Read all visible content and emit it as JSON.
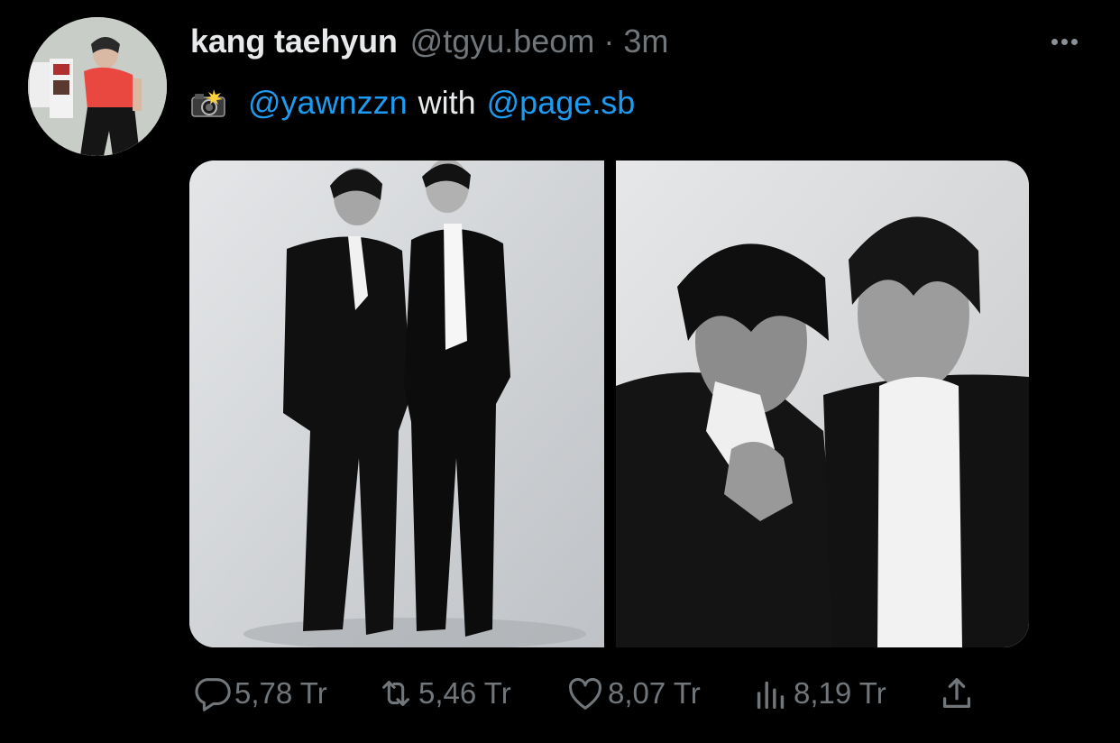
{
  "tweet": {
    "author": {
      "display_name": "kang taehyun",
      "handle": "@tgyu.beom",
      "avatar_icon": "avatar-photo"
    },
    "separator": "·",
    "timestamp": "3m",
    "text": {
      "emoji": "📸",
      "mention_1": "@yawnzzn",
      "connector": "with",
      "mention_2": "@page.sb"
    },
    "media": [
      {
        "alt_icon": "photo-two-men-in-suits-full-body"
      },
      {
        "alt_icon": "photo-two-men-close-up"
      }
    ],
    "actions": {
      "reply": {
        "icon": "reply-icon",
        "count": "5,78 Tr"
      },
      "retweet": {
        "icon": "retweet-icon",
        "count": "5,46 Tr"
      },
      "like": {
        "icon": "heart-icon",
        "count": "8,07 Tr"
      },
      "views": {
        "icon": "views-icon",
        "count": "8,19 Tr"
      },
      "share": {
        "icon": "share-icon"
      }
    }
  },
  "colors": {
    "background": "#000000",
    "primary_text": "#e7e9ea",
    "secondary_text": "#71767b",
    "link": "#1d9bf0"
  }
}
